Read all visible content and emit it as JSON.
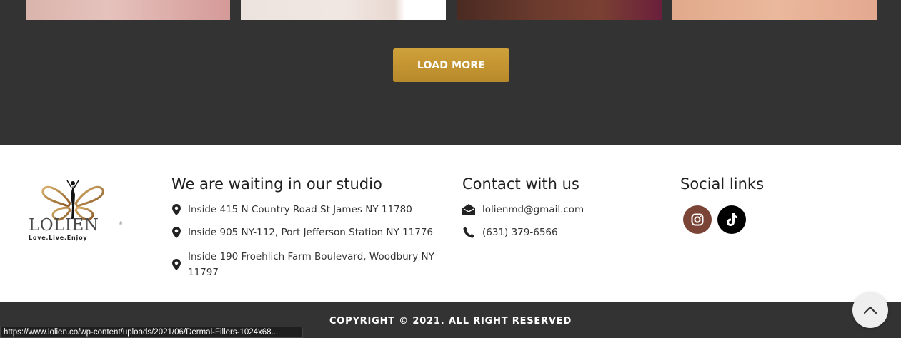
{
  "gallery": {
    "load_more_label": "LOAD MORE"
  },
  "logo": {
    "name": "LOLIEN",
    "tagline": "Love.Live.Enjoy"
  },
  "studio": {
    "title": "We are waiting in our studio",
    "addresses": [
      "Inside 415 N Country Road St James NY 11780",
      "Inside 905 NY-112, Port Jefferson Station NY 11776",
      "Inside 190 Froehlich Farm Boulevard, Woodbury NY 11797"
    ]
  },
  "contact": {
    "title": "Contact with us",
    "email": "lolienmd@gmail.com",
    "phone": "(631) 379-6566"
  },
  "social": {
    "title": "Social links",
    "links": [
      {
        "name": "instagram-icon",
        "color": "#7a4536"
      },
      {
        "name": "tiktok-icon",
        "color": "#000000"
      }
    ]
  },
  "footer": {
    "copyright": "COPYRIGHT © 2021. ALL RIGHT RESERVED"
  },
  "status_bar": {
    "url": "https://www.lolien.co/wp-content/uploads/2021/06/Dermal-Fillers-1024x68..."
  },
  "colors": {
    "dark_bg": "#333333",
    "gold": "#c29431",
    "text": "#333333"
  }
}
